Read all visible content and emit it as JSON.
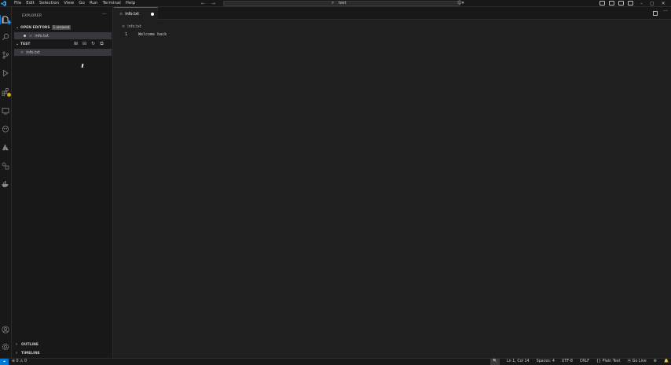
{
  "window": {
    "menu": [
      "File",
      "Edit",
      "Selection",
      "View",
      "Go",
      "Run",
      "Terminal",
      "Help"
    ],
    "search_text": "test",
    "back_glyph": "←",
    "forward_glyph": "→",
    "window_controls": [
      "–",
      "▢",
      "✕"
    ]
  },
  "activity": {
    "explorer_badge": "1",
    "extensions_badge": "!"
  },
  "sidebar": {
    "title": "EXPLORER",
    "more": "···",
    "open_editors": {
      "label": "OPEN EDITORS",
      "badge": "1 unsaved",
      "files": [
        {
          "icon": "≡",
          "name": "info.txt"
        }
      ]
    },
    "folder": {
      "label": "TEST",
      "files": [
        {
          "icon": "≡",
          "name": "info.txt"
        }
      ]
    },
    "outline_label": "OUTLINE",
    "timeline_label": "TIMELINE"
  },
  "editor": {
    "tab": {
      "icon": "≡",
      "name": "info.txt"
    },
    "breadcrumb": "info.txt",
    "lines": [
      {
        "num": "1",
        "text": "Welcome back"
      }
    ]
  },
  "statusbar": {
    "remote": "⌖",
    "problems": "⊗ 0 ⚠ 0",
    "ports": "",
    "zoom": "🔍",
    "position": "Ln 1, Col 14",
    "spaces": "Spaces: 4",
    "encoding": "UTF-8",
    "eol": "CRLF",
    "language": "{} Plain Text",
    "golive": "⦿ Go Live"
  },
  "colors": {
    "accent": "#0078d4",
    "warning_badge": "#c9a500",
    "background": "#1f1f1f",
    "chrome": "#181818"
  }
}
